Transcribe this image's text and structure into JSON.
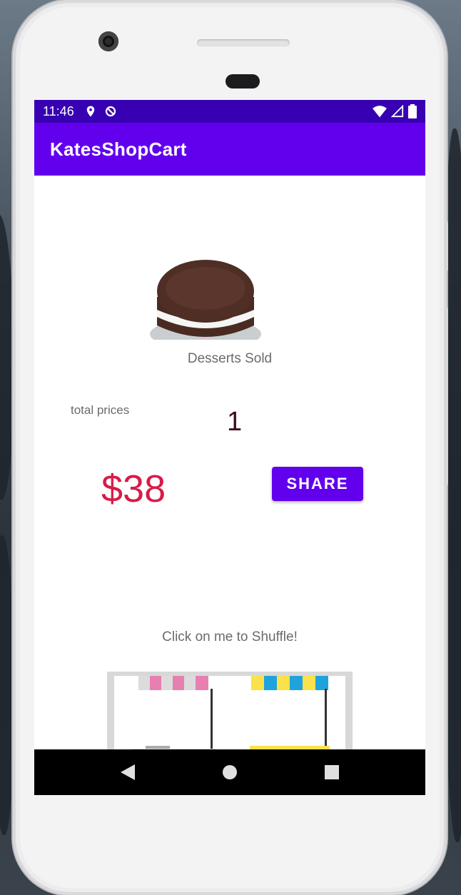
{
  "status_bar": {
    "time": "11:46"
  },
  "app_bar": {
    "title": "KatesShopCart"
  },
  "main": {
    "desserts_sold_label": "Desserts Sold",
    "total_prices_label": "total prices",
    "desserts_sold_count": "1",
    "total_price": "$38",
    "share_button_label": "SHARE",
    "shuffle_label": "Click on me to Shuffle!"
  },
  "colors": {
    "status_bar": "#3700b3",
    "app_bar": "#6200ee",
    "price": "#d81b48",
    "count": "#3d0a1f"
  },
  "icons": [
    "location-icon",
    "data-saver-icon",
    "wifi-icon",
    "signal-icon",
    "battery-icon",
    "back-icon",
    "home-icon",
    "recents-icon"
  ]
}
